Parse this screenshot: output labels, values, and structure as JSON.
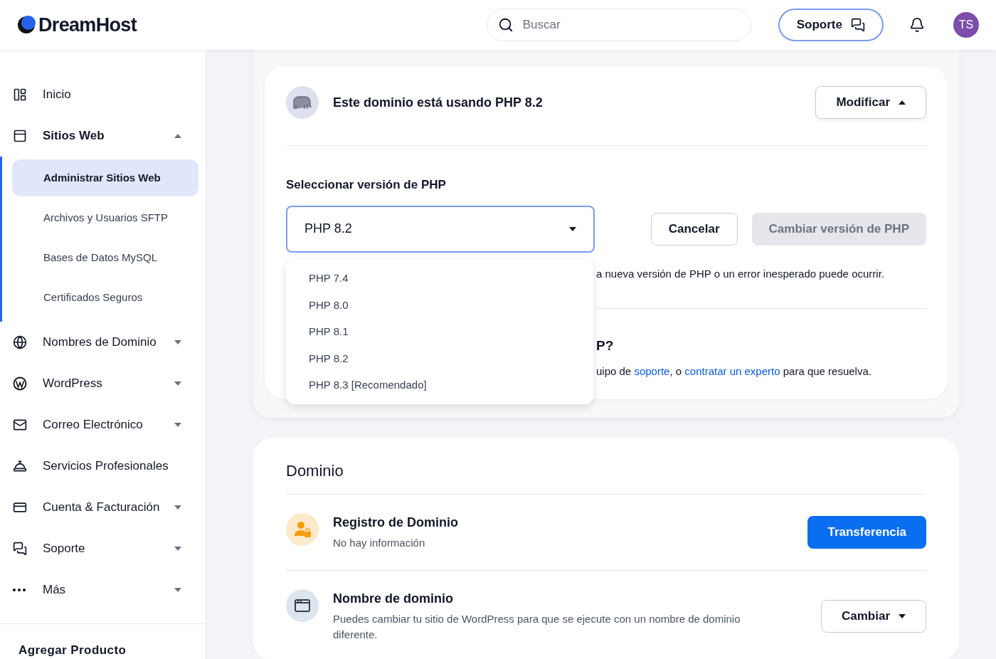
{
  "header": {
    "logo": "DreamHost",
    "search": {
      "placeholder": "Buscar"
    },
    "support_button": "Soporte",
    "avatar": "TS"
  },
  "sidebar": {
    "items": [
      {
        "label": "Inicio",
        "kind": "link",
        "expanded": false,
        "selected": false
      },
      {
        "label": "Sitios Web",
        "kind": "group",
        "expanded": true,
        "selected": false,
        "children": [
          {
            "label": "Administrar Sitios Web",
            "selected": true
          },
          {
            "label": "Archivos y Usuarios SFTP",
            "selected": false
          },
          {
            "label": "Bases de Datos MySQL",
            "selected": false
          },
          {
            "label": "Certificados Seguros",
            "selected": false
          }
        ]
      },
      {
        "label": "Nombres de Dominio",
        "kind": "group",
        "expanded": false,
        "selected": false
      },
      {
        "label": "WordPress",
        "kind": "group",
        "expanded": false,
        "selected": false
      },
      {
        "label": "Correo Electrónico",
        "kind": "group",
        "expanded": false,
        "selected": false
      },
      {
        "label": "Servicios Profesionales",
        "kind": "link",
        "expanded": false,
        "selected": false
      },
      {
        "label": "Cuenta & Facturación",
        "kind": "group",
        "expanded": false,
        "selected": false
      },
      {
        "label": "Soporte",
        "kind": "group",
        "expanded": false,
        "selected": false
      },
      {
        "label": "Más",
        "kind": "group",
        "expanded": false,
        "selected": false
      }
    ],
    "footer": "Agregar Producto"
  },
  "php_card": {
    "status": "Este dominio está usando PHP 8.2",
    "modify_button": {
      "label": "Modificar",
      "expanded": true
    },
    "select_label": "Seleccionar versión de PHP",
    "select": {
      "value": "PHP 8.2",
      "open": true,
      "options": [
        "PHP 7.4",
        "PHP 8.0",
        "PHP 8.1",
        "PHP 8.2",
        "PHP 8.3 [Recomendado]"
      ]
    },
    "buttons": [
      {
        "label": "Cancelar",
        "kind": "secondary",
        "disabled": false
      },
      {
        "label": "Cambiar versión de PHP",
        "kind": "primary",
        "disabled": true
      }
    ],
    "note": "a nueva versión de PHP o un error inesperado puede ocurrir.",
    "help_heading": "P?",
    "help_text": [
      {
        "kind": "text",
        "text": "uipo de "
      },
      {
        "kind": "link",
        "text": "soporte"
      },
      {
        "kind": "text",
        "text": ", o "
      },
      {
        "kind": "link",
        "text": "contratar un experto"
      },
      {
        "kind": "text",
        "text": " para que resuelva."
      }
    ]
  },
  "domain_card": {
    "title": "Dominio",
    "rows": [
      {
        "title": "Registro de Dominio",
        "subtitle": "No hay información",
        "action": {
          "label": "Transferencia",
          "kind": "primary"
        }
      },
      {
        "title": "Nombre de dominio",
        "subtitle": "Puedes cambiar tu sitio de WordPress para que se ejecute con un nombre de dominio diferente.",
        "action": {
          "label": "Cambiar",
          "kind": "dropdown"
        }
      }
    ]
  }
}
